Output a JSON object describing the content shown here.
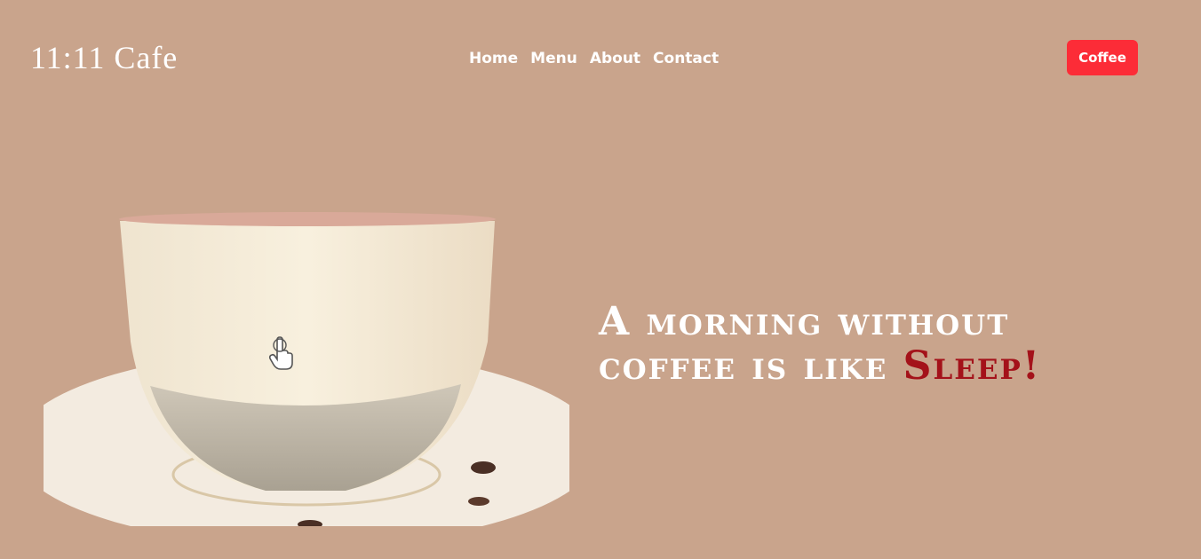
{
  "header": {
    "logo": "11:11 Cafe",
    "nav": [
      "Home",
      "Menu",
      "About",
      "Contact"
    ],
    "cta_label": "Coffee"
  },
  "hero": {
    "headline_line1": "A morning without",
    "headline_line2": "coffee is like ",
    "headline_accent": "Sleep!",
    "viewer_icon": "hand-pointer-icon"
  },
  "colors": {
    "background": "#c9a48c",
    "cta": "#fc2c37",
    "accent": "#a4121a",
    "text": "#ffffff"
  }
}
